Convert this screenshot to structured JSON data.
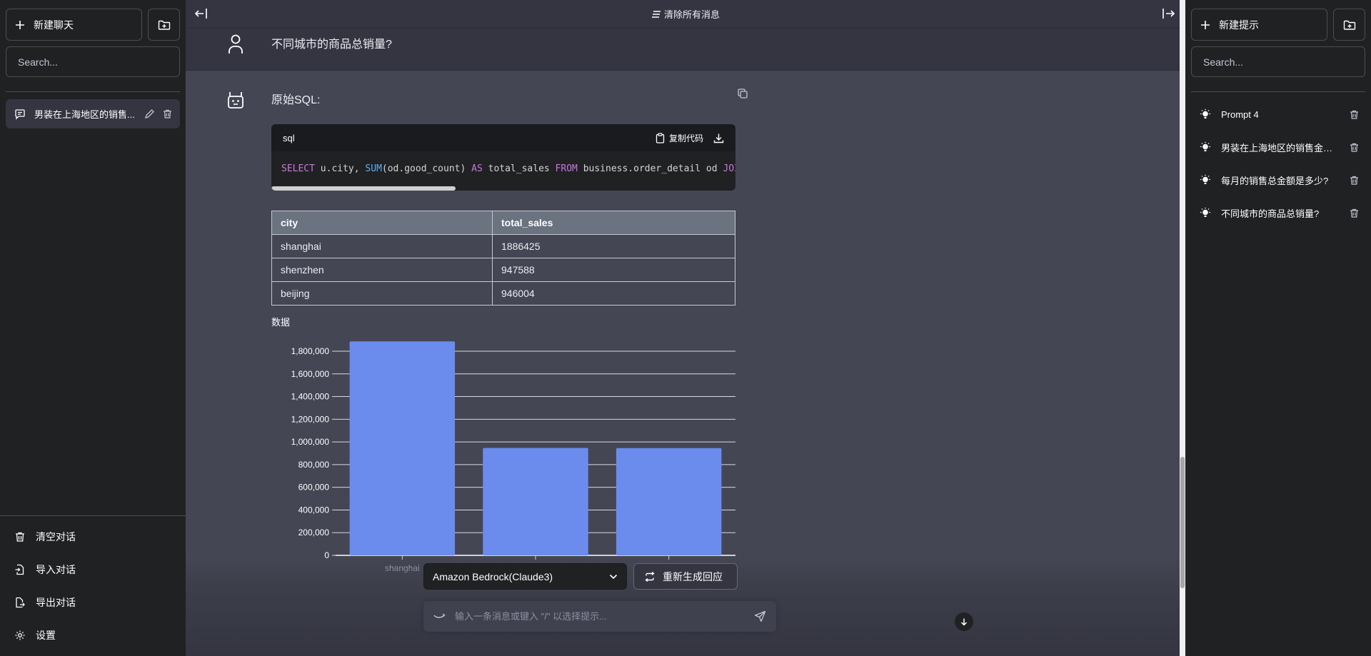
{
  "left_sidebar": {
    "new_chat_label": "新建聊天",
    "search_placeholder": "Search...",
    "conversations": [
      {
        "label": "男装在上海地区的销售..."
      }
    ],
    "bottom_items": [
      {
        "label": "清空对话",
        "icon": "trash-icon"
      },
      {
        "label": "导入对话",
        "icon": "import-file-icon"
      },
      {
        "label": "导出对话",
        "icon": "export-file-icon"
      },
      {
        "label": "设置",
        "icon": "gear-icon"
      }
    ]
  },
  "main": {
    "clear_all_label": "清除所有消息",
    "user_message": "不同城市的商品总销量?",
    "bot_heading": "原始SQL:",
    "code": {
      "language": "sql",
      "copy_label": "复制代码",
      "sql": "SELECT u.city, SUM(od.good_count) AS total_sales FROM business.order_detail od JOIN"
    },
    "table": {
      "columns": [
        "city",
        "total_sales"
      ],
      "rows": [
        [
          "shanghai",
          "1886425"
        ],
        [
          "shenzhen",
          "947588"
        ],
        [
          "beijing",
          "946004"
        ]
      ]
    },
    "chart_label": "数据",
    "model_select": "Amazon Bedrock(Claude3)",
    "regenerate_label": "重新生成回应",
    "input_placeholder": "输入一条消息或键入 \"/\" 以选择提示..."
  },
  "right_sidebar": {
    "new_prompt_label": "新建提示",
    "search_placeholder": "Search...",
    "prompts": [
      {
        "label": "Prompt 4"
      },
      {
        "label": "男装在上海地区的销售金额是..."
      },
      {
        "label": "每月的销售总金额是多少?"
      },
      {
        "label": "不同城市的商品总销量?"
      }
    ]
  },
  "colors": {
    "bar": "#6b8ced",
    "main_bg": "#444654",
    "sidebar_bg": "#202123"
  },
  "chart_data": {
    "type": "bar",
    "title": "数据",
    "categories": [
      "shanghai",
      "shenzhen",
      "beijing"
    ],
    "visible_x_labels": [
      "shanghai"
    ],
    "values": [
      1886425,
      947588,
      946004
    ],
    "xlabel": "",
    "ylabel": "",
    "ylim": [
      0,
      1800000
    ],
    "yticks": [
      0,
      200000,
      400000,
      600000,
      800000,
      1000000,
      1200000,
      1400000,
      1600000,
      1800000
    ],
    "ytick_labels": [
      "0",
      "200,000",
      "400,000",
      "600,000",
      "800,000",
      "1,000,000",
      "1,200,000",
      "1,400,000",
      "1,600,000",
      "1,800,000"
    ],
    "grid": true,
    "legend": "none"
  }
}
